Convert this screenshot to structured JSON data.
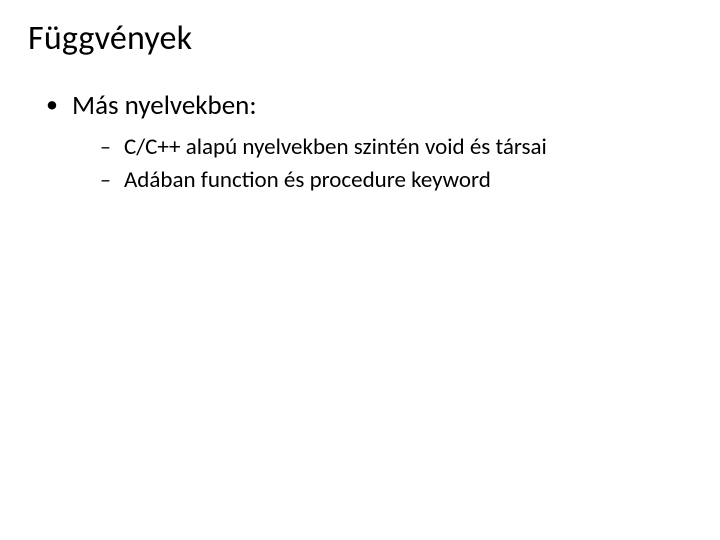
{
  "slide": {
    "title": "Függvények",
    "bullets": [
      {
        "text": "Más nyelvekben:",
        "subbullets": [
          "C/C++ alapú nyelvekben szintén void és társai",
          "Adában function és procedure keyword"
        ]
      }
    ]
  }
}
